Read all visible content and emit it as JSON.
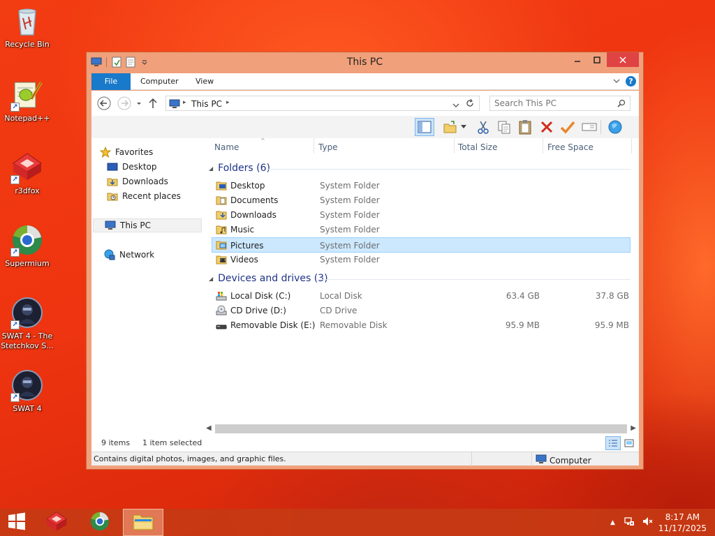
{
  "desktop": {
    "icons": [
      {
        "label": "Recycle Bin",
        "icon": "recycle-bin-icon"
      },
      {
        "label": "Notepad++",
        "icon": "notepad-plus-plus-icon"
      },
      {
        "label": "r3dfox",
        "icon": "r3dfox-icon"
      },
      {
        "label": "Supermium",
        "icon": "supermium-icon"
      },
      {
        "label": "SWAT 4 - The Stetchkov S...",
        "icon": "swat4-stetchkov-icon"
      },
      {
        "label": "SWAT 4",
        "icon": "swat4-icon"
      }
    ]
  },
  "window": {
    "title": "This PC",
    "ribbon_tabs": [
      "File",
      "Computer",
      "View"
    ],
    "address": {
      "crumb": "This PC"
    },
    "search": {
      "placeholder": "Search This PC"
    },
    "navigation": {
      "favorites_label": "Favorites",
      "favorites": [
        "Desktop",
        "Downloads",
        "Recent places"
      ],
      "this_pc": "This PC",
      "network": "Network"
    },
    "columns": {
      "name": "Name",
      "type": "Type",
      "total_size": "Total Size",
      "free_space": "Free Space"
    },
    "groups": [
      {
        "title": "Folders (6)",
        "items": [
          {
            "name": "Desktop",
            "type": "System Folder",
            "icon": "desktop-folder-icon"
          },
          {
            "name": "Documents",
            "type": "System Folder",
            "icon": "documents-folder-icon"
          },
          {
            "name": "Downloads",
            "type": "System Folder",
            "icon": "downloads-folder-icon"
          },
          {
            "name": "Music",
            "type": "System Folder",
            "icon": "music-folder-icon"
          },
          {
            "name": "Pictures",
            "type": "System Folder",
            "icon": "pictures-folder-icon",
            "selected": true
          },
          {
            "name": "Videos",
            "type": "System Folder",
            "icon": "videos-folder-icon"
          }
        ]
      },
      {
        "title": "Devices and drives (3)",
        "items": [
          {
            "name": "Local Disk (C:)",
            "type": "Local Disk",
            "total": "63.4 GB",
            "free": "37.8 GB",
            "icon": "local-disk-icon"
          },
          {
            "name": "CD Drive (D:)",
            "type": "CD Drive",
            "total": "",
            "free": "",
            "icon": "cd-drive-icon"
          },
          {
            "name": "Removable Disk (E:)",
            "type": "Removable Disk",
            "total": "95.9 MB",
            "free": "95.9 MB",
            "icon": "removable-disk-icon"
          }
        ]
      }
    ],
    "status": {
      "item_count": "9 items",
      "selection": "1 item selected",
      "description": "Contains digital photos, images, and graphic files.",
      "zone": "Computer"
    }
  },
  "taskbar": {
    "clock_time": "8:17 AM",
    "clock_date": "11/17/2025"
  },
  "colors": {
    "accent": "#1979ca",
    "selection": "#cce8ff",
    "window_frame": "#f0a07a",
    "taskbar": "#c63a14"
  }
}
